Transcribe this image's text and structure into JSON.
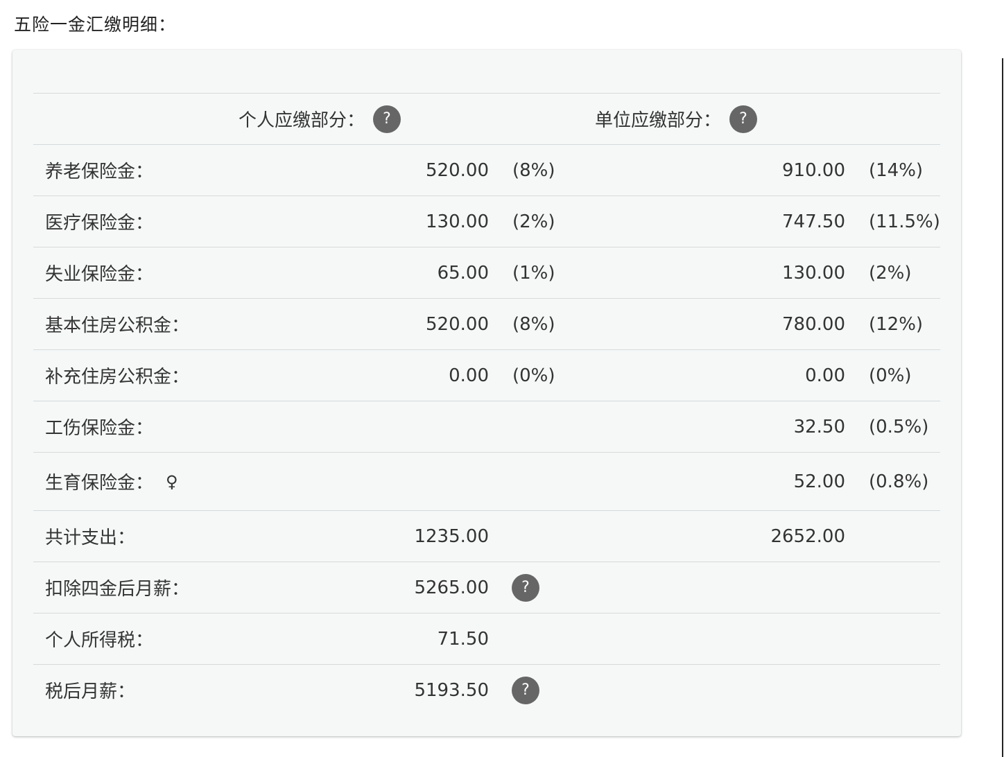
{
  "title": "五险一金汇缴明细：",
  "header": {
    "personal": "个人应缴部分：",
    "company": "单位应缴部分："
  },
  "rows": [
    {
      "label": "养老保险金：",
      "p_val": "520.00",
      "p_pct": "(8%)",
      "c_val": "910.00",
      "c_pct": "(14%)"
    },
    {
      "label": "医疗保险金：",
      "p_val": "130.00",
      "p_pct": "(2%)",
      "c_val": "747.50",
      "c_pct": "(11.5%)"
    },
    {
      "label": "失业保险金：",
      "p_val": "65.00",
      "p_pct": "(1%)",
      "c_val": "130.00",
      "c_pct": "(2%)"
    },
    {
      "label": "基本住房公积金：",
      "p_val": "520.00",
      "p_pct": "(8%)",
      "c_val": "780.00",
      "c_pct": "(12%)"
    },
    {
      "label": "补充住房公积金：",
      "p_val": "0.00",
      "p_pct": "(0%)",
      "c_val": "0.00",
      "c_pct": "(0%)"
    },
    {
      "label": "工伤保险金：",
      "c_val": "32.50",
      "c_pct": "(0.5%)"
    },
    {
      "label": "生育保险金：",
      "symbol": "♀",
      "c_val": "52.00",
      "c_pct": "(0.8%)"
    }
  ],
  "totals": {
    "label": "共计支出：",
    "personal": "1235.00",
    "company": "2652.00"
  },
  "after_four": {
    "label": "扣除四金后月薪：",
    "value": "5265.00"
  },
  "income_tax": {
    "label": "个人所得税：",
    "value": "71.50"
  },
  "after_tax": {
    "label": "税后月薪：",
    "value": "5193.50"
  },
  "help_icon_glyph": "?",
  "colors": {
    "card_bg": "#f6f8f8",
    "icon_bg": "#666666",
    "divider": "#d6dada"
  }
}
